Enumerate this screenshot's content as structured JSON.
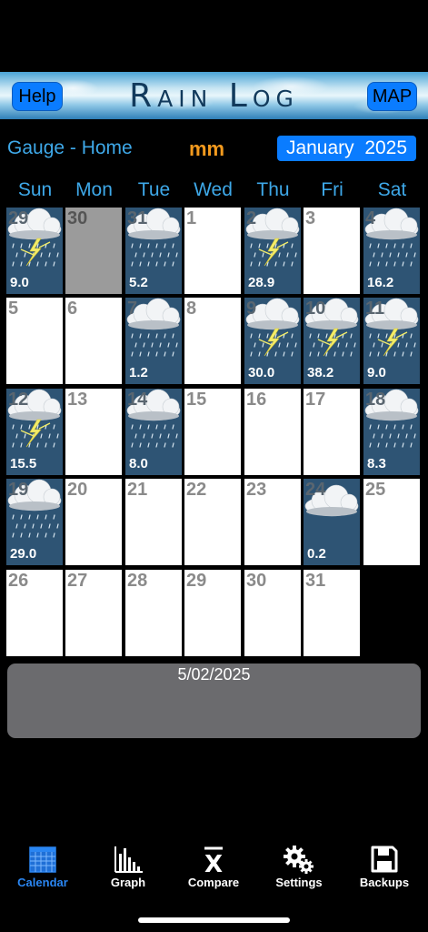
{
  "header": {
    "title": "Rain Log",
    "help_label": "Help",
    "map_label": "MAP"
  },
  "gauge": {
    "label": "Gauge - Home",
    "unit": "mm",
    "month": "January  2025"
  },
  "weekdays": [
    "Sun",
    "Mon",
    "Tue",
    "Wed",
    "Thu",
    "Fri",
    "Sat"
  ],
  "days": [
    {
      "n": "29",
      "type": "storm",
      "amt": "9.0"
    },
    {
      "n": "30",
      "type": "gray",
      "amt": ""
    },
    {
      "n": "31",
      "type": "rain",
      "amt": "5.2"
    },
    {
      "n": "1",
      "type": "empty",
      "amt": ""
    },
    {
      "n": "2",
      "type": "storm",
      "amt": "28.9"
    },
    {
      "n": "3",
      "type": "empty",
      "amt": ""
    },
    {
      "n": "4",
      "type": "rain",
      "amt": "16.2"
    },
    {
      "n": "5",
      "type": "empty",
      "amt": ""
    },
    {
      "n": "6",
      "type": "empty",
      "amt": ""
    },
    {
      "n": "7",
      "type": "rain",
      "amt": "1.2"
    },
    {
      "n": "8",
      "type": "empty",
      "amt": ""
    },
    {
      "n": "9",
      "type": "storm",
      "amt": "30.0"
    },
    {
      "n": "10",
      "type": "storm",
      "amt": "38.2"
    },
    {
      "n": "11",
      "type": "storm",
      "amt": "9.0"
    },
    {
      "n": "12",
      "type": "storm",
      "amt": "15.5"
    },
    {
      "n": "13",
      "type": "empty",
      "amt": ""
    },
    {
      "n": "14",
      "type": "rain",
      "amt": "8.0"
    },
    {
      "n": "15",
      "type": "empty",
      "amt": ""
    },
    {
      "n": "16",
      "type": "empty",
      "amt": ""
    },
    {
      "n": "17",
      "type": "empty",
      "amt": ""
    },
    {
      "n": "18",
      "type": "rain",
      "amt": "8.3"
    },
    {
      "n": "19",
      "type": "rain",
      "amt": "29.0"
    },
    {
      "n": "20",
      "type": "empty",
      "amt": ""
    },
    {
      "n": "21",
      "type": "empty",
      "amt": ""
    },
    {
      "n": "22",
      "type": "empty",
      "amt": ""
    },
    {
      "n": "23",
      "type": "empty",
      "amt": ""
    },
    {
      "n": "24",
      "type": "cloud",
      "amt": "0.2"
    },
    {
      "n": "25",
      "type": "empty",
      "amt": ""
    },
    {
      "n": "26",
      "type": "empty",
      "amt": ""
    },
    {
      "n": "27",
      "type": "empty",
      "amt": ""
    },
    {
      "n": "28",
      "type": "empty",
      "amt": ""
    },
    {
      "n": "29",
      "type": "empty",
      "amt": ""
    },
    {
      "n": "30",
      "type": "empty",
      "amt": ""
    },
    {
      "n": "31",
      "type": "empty",
      "amt": ""
    }
  ],
  "selected_date": "5/02/2025",
  "tabs": [
    {
      "label": "Calendar",
      "icon": "calendar-icon",
      "active": true
    },
    {
      "label": "Graph",
      "icon": "bar-graph-icon",
      "active": false
    },
    {
      "label": "Compare",
      "icon": "x-bar-icon",
      "active": false
    },
    {
      "label": "Settings",
      "icon": "gears-icon",
      "active": false
    },
    {
      "label": "Backups",
      "icon": "floppy-disk-icon",
      "active": false
    }
  ],
  "colors": {
    "accent": "#0a7cff",
    "label_blue": "#3ea8e8",
    "unit_orange": "#f39a1e",
    "rain_cell": "#2e5474"
  }
}
